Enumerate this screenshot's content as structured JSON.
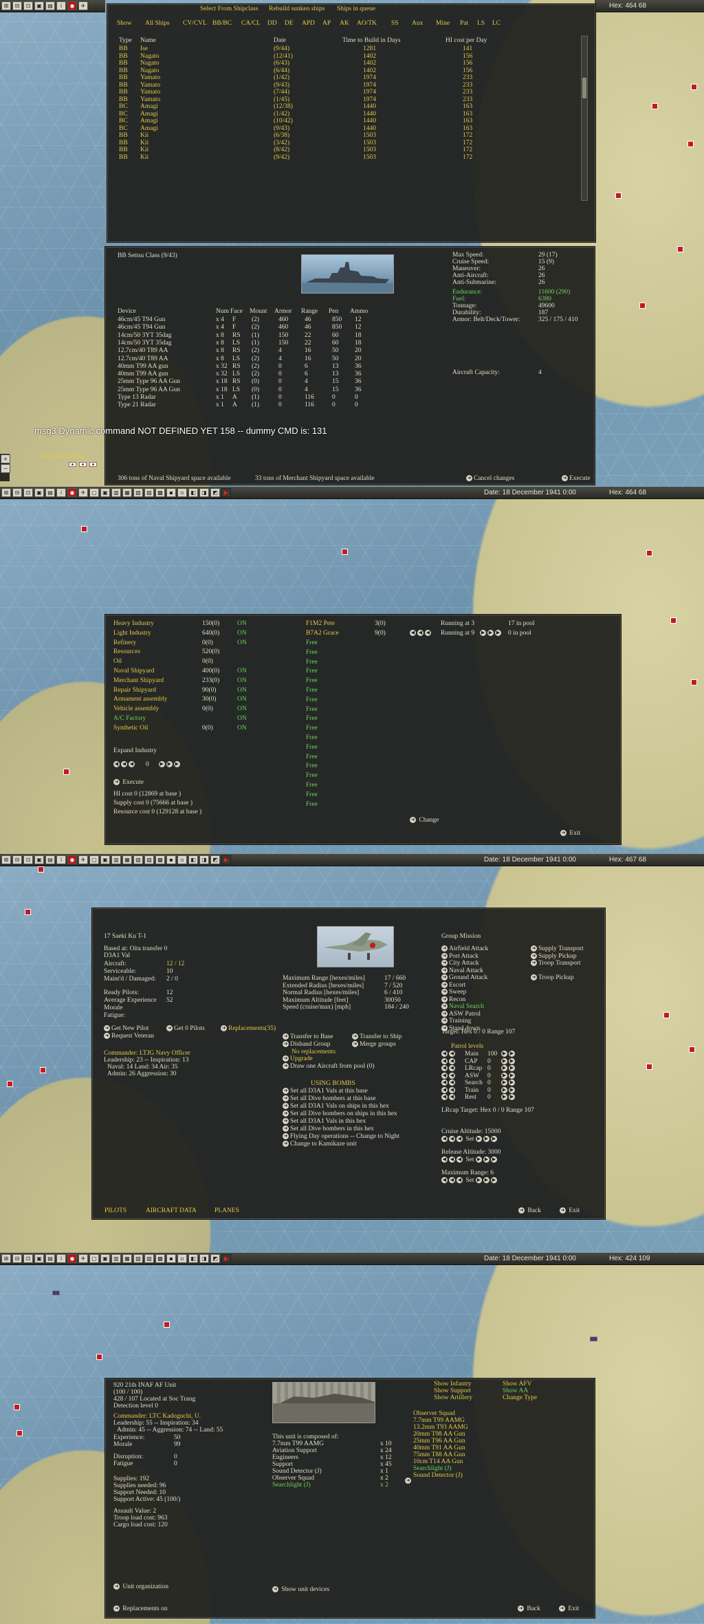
{
  "toolbar": {
    "date_label": "Date: 18 December 1941 0:00",
    "hex_label_1": "Hex: 464  68",
    "hex_label_2": "Hex: 464  68",
    "hex_label_3": "Hex: 467  68",
    "hex_label_4": "Hex: 424  109",
    "buttons": [
      "⊞",
      "⊟",
      "⊡",
      "▣",
      "▤",
      "i",
      "◉",
      "✈",
      "▢",
      "▣",
      "▥",
      "▦",
      "▧",
      "▨",
      "▩",
      "▪",
      "▫",
      "◧",
      "◨",
      "◩",
      "▶"
    ]
  },
  "shipyard": {
    "top_links": [
      "Select From Shipclass",
      "Rebuild sunken ships",
      "Ships in queue"
    ],
    "filters": [
      "Show",
      "All Ships",
      "CV/CVL",
      "BB/BC",
      "CA/CL",
      "DD",
      "DE",
      "APD",
      "AP",
      "AK",
      "AO/TK",
      "SS",
      "Aux",
      "Mine",
      "Pat",
      "LS",
      "LC"
    ],
    "columns": [
      "Type",
      "Name",
      "Date",
      "Time to Build in Days",
      "HI cost per Day"
    ],
    "rows": [
      [
        "BB",
        "Ise",
        "(9/44)",
        "1281",
        "141"
      ],
      [
        "BB",
        "Nagato",
        "(12/41)",
        "1402",
        "156"
      ],
      [
        "BB",
        "Nagato",
        "(6/43)",
        "1402",
        "156"
      ],
      [
        "BB",
        "Nagato",
        "(6/44)",
        "1402",
        "156"
      ],
      [
        "BB",
        "Yamato",
        "(1/42)",
        "1974",
        "233"
      ],
      [
        "BB",
        "Yamato",
        "(9/43)",
        "1974",
        "233"
      ],
      [
        "BB",
        "Yamato",
        "(7/44)",
        "1974",
        "233"
      ],
      [
        "BB",
        "Yamato",
        "(1/45)",
        "1974",
        "233"
      ],
      [
        "BC",
        "Amagi",
        "(12/38)",
        "1440",
        "163"
      ],
      [
        "BC",
        "Amagi",
        "(1/42)",
        "1440",
        "163"
      ],
      [
        "BC",
        "Amagi",
        "(10/42)",
        "1440",
        "163"
      ],
      [
        "BC",
        "Amagi",
        "(9/43)",
        "1440",
        "163"
      ],
      [
        "BB",
        "Kii",
        "(6/38)",
        "1503",
        "172"
      ],
      [
        "BB",
        "Kii",
        "(3/42)",
        "1503",
        "172"
      ],
      [
        "BB",
        "Kii",
        "(8/42)",
        "1503",
        "172"
      ],
      [
        "BB",
        "Kii",
        "(9/42)",
        "1503",
        "172"
      ]
    ]
  },
  "ship_detail": {
    "title": "BB Settsu Class (9/43)",
    "columns": [
      "Device",
      "Num",
      "Face",
      "Mount",
      "Armor",
      "Range",
      "Pen",
      "Ammo"
    ],
    "devices": [
      [
        "46cm/45 T94 Gun",
        "x 4",
        "F",
        "(2)",
        "460",
        "46",
        "850",
        "12"
      ],
      [
        "46cm/45 T94 Gun",
        "x 4",
        "F",
        "(2)",
        "460",
        "46",
        "850",
        "12"
      ],
      [
        "14cm/50 3YT 35dag",
        "x 8",
        "RS",
        "(1)",
        "150",
        "22",
        "60",
        "18"
      ],
      [
        "14cm/50 3YT 35dag",
        "x 8",
        "LS",
        "(1)",
        "150",
        "22",
        "60",
        "18"
      ],
      [
        "12.7cm/40 T89 AA",
        "x 8",
        "RS",
        "(2)",
        "4",
        "16",
        "50",
        "20"
      ],
      [
        "12.7cm/40 T89 AA",
        "x 8",
        "LS",
        "(2)",
        "4",
        "16",
        "50",
        "20"
      ],
      [
        "40mm T99 AA gun",
        "x 32",
        "RS",
        "(2)",
        "0",
        "6",
        "13",
        "36"
      ],
      [
        "40mm T99 AA gun",
        "x 32",
        "LS",
        "(2)",
        "0",
        "6",
        "13",
        "36"
      ],
      [
        "25mm Type 96 AA Gun",
        "x 18",
        "RS",
        "(0)",
        "0",
        "4",
        "15",
        "36"
      ],
      [
        "25mm Type 96 AA Gun",
        "x 18",
        "LS",
        "(0)",
        "0",
        "4",
        "15",
        "36"
      ],
      [
        "Type 13 Radar",
        "x 1",
        "A",
        "(1)",
        "0",
        "116",
        "0",
        "0"
      ],
      [
        "Type 21 Radar",
        "x 1",
        "A",
        "(1)",
        "0",
        "116",
        "0",
        "0"
      ]
    ],
    "stats": [
      [
        "Max Speed:",
        "29 (17)",
        "w"
      ],
      [
        "Cruise Speed:",
        "15 (9)",
        "w"
      ],
      [
        "Maneuver:",
        "26",
        "w"
      ],
      [
        "Anti-Aircraft:",
        "26",
        "w"
      ],
      [
        "Anti-Submarine:",
        "26",
        "w"
      ],
      [
        "Endurance:",
        "11600 (290)",
        "g"
      ],
      [
        "Fuel:",
        "6380",
        "g"
      ],
      [
        "Tonnage:",
        "49600",
        "w"
      ],
      [
        "Durability:",
        "187",
        "w"
      ],
      [
        "Armor: Belt/Deck/Tower:",
        "325 / 175 / 410",
        "w"
      ]
    ],
    "aircraft_capacity_label": "Aircraft Capacity:",
    "aircraft_capacity_value": "4",
    "naval_space": "306 tons of Naval Shipyard space available",
    "merchant_space": "33 tons of Merchant Shipyard space available",
    "cancel_label": "Cancel changes",
    "execute_label": "Execute"
  },
  "debug_message": "msg3 Dynamic command NOT DEFINED YET 158 -- dummy CMD is: 131",
  "base_label": "Nagasaki/Sasebo",
  "industry": {
    "items": [
      [
        "Heavy Industry",
        "150(0)",
        "ON",
        "y"
      ],
      [
        "Light Industry",
        "640(0)",
        "ON",
        "y"
      ],
      [
        "Refinery",
        "0(0)",
        "ON",
        "y"
      ],
      [
        "Resources",
        "520(0)",
        "",
        "y"
      ],
      [
        "Oil",
        "0(0)",
        "",
        "y"
      ],
      [
        "Naval Shipyard",
        "400(0)",
        "ON",
        "y"
      ],
      [
        "Merchant Shipyard",
        "233(0)",
        "ON",
        "y"
      ],
      [
        "Repair Shipyard",
        "90(0)",
        "ON",
        "y"
      ],
      [
        "Armament assembly",
        "30(0)",
        "ON",
        "y"
      ],
      [
        "Vehicle assembly",
        "0(0)",
        "ON",
        "y"
      ],
      [
        "A/C Factory",
        "",
        "ON",
        "g"
      ],
      [
        "Synthetic Oil",
        "0(0)",
        "ON",
        "y"
      ]
    ],
    "factories": [
      [
        "F1M2 Pete",
        "3(0)",
        "Running at 3",
        "17 in pool"
      ],
      [
        "B7A2 Grace",
        "9(0)",
        "Running at 9",
        "0 in pool"
      ]
    ],
    "free_label": "Free",
    "free_count": 18,
    "expand_label": "Expand Industry",
    "expand_value": "0",
    "execute_label": "Execute",
    "hi_cost": "HI cost 0 (12869 at base )",
    "supply_cost": "Supply cost 0 (75666 at base )",
    "resource_cost": "Resource cost 0 (129128 at base )",
    "change_label": "Change",
    "exit_label": "Exit"
  },
  "air_group": {
    "name": "17 Saeki Ku T-1",
    "based_at": "Based at: Oita transfer 0",
    "aircraft_type": "D3A1 Val",
    "aircraft_label": "Aircraft:",
    "aircraft_value": "12 / 12",
    "serviceable_label": "Serviceable:",
    "serviceable_value": "10",
    "maint_label": "Maint'd / Damaged:",
    "maint_value": "2 / 0",
    "ready_pilots_label": "Ready Pilots:",
    "ready_pilots_value": "12",
    "avg_exp_label": "Average Experience",
    "avg_exp_value": "52",
    "morale_label": "Morale",
    "fatigue_label": "Fatigue:",
    "get_new_pilot": "Get New Pilot",
    "get_0_pilots": "Get 0 Pilots",
    "replacements": "Replacements(35)",
    "request_veteran": "Request Veteran",
    "commander": "Commander: LTJG Navy Officer",
    "leadership": "Leadership: 23 -- Inspiration: 13",
    "naval_land": "Naval: 14  Land: 34  Air: 35",
    "admin": "Admin: 26  Aggression: 30",
    "range_stats": [
      [
        "Maximum Range [hexes/miles]",
        "17 / 660"
      ],
      [
        "Extended Radius [hexes/miles]",
        "7 / 520"
      ],
      [
        "Normal Radius [hexes/miles]",
        "6 / 410"
      ],
      [
        "Maximum Altitude [feet]",
        "30050"
      ],
      [
        "Speed (cruise/max) [mph]",
        "184 / 240"
      ]
    ],
    "actions": [
      "Transfer to Base",
      "Transfer to Ship",
      "Disband Group",
      "Merge groups"
    ],
    "no_replacements": "No replacements",
    "upgrade": "Upgrade",
    "draw_aircraft": "Draw one Aircraft from pool (0)",
    "using_bombs": "USING BOMBS",
    "set_actions": [
      "Set all D3A1 Vals at this base",
      "Set all Dive bombers at this base",
      "Set all D3A1 Vals on ships in this hex",
      "Set all Dive bombers on ships in this hex",
      "Set all D3A1 Vals in this hex",
      "Set all Dive bombers in this hex",
      "Flying Day operations -- Change to Night",
      "Change to Kamikaze unit"
    ],
    "group_mission_label": "Group Mission",
    "missions_left": [
      "Airfield Attack",
      "Port Attack",
      "City Attack",
      "Naval Attack",
      "Ground Attack",
      "Escort",
      "Sweep",
      "Recon",
      "Naval Search",
      "ASW Patrol",
      "Training",
      "Stand down"
    ],
    "missions_right": [
      "Supply Transport",
      "Supply Pickup",
      "Troop Transport",
      "",
      "Troop Pickup"
    ],
    "target_line": "Target: Hex 0 / 0 Range 107",
    "patrol_label": "Patrol levels",
    "patrol_items": [
      [
        "Main",
        "100"
      ],
      [
        "CAP",
        "0"
      ],
      [
        "LRcap",
        "0"
      ],
      [
        "ASW",
        "0"
      ],
      [
        "Search",
        "0"
      ],
      [
        "Train",
        "0"
      ],
      [
        "Rest",
        "0"
      ]
    ],
    "lrcap_target": "LRcap Target: Hex 0 / 0 Range 107",
    "cruise_alt": "Cruise Altitude: 15000",
    "release_alt": "Release Altitude: 3000",
    "max_range": "Maximum Range: 6",
    "set_label": "Set",
    "bottom_links": [
      "PILOTS",
      "AIRCRAFT DATA",
      "PLANES"
    ],
    "back_label": "Back",
    "exit_label": "Exit"
  },
  "ground_unit": {
    "name": "920 21th INAF AF Unit",
    "strength": "(100 / 100)",
    "location": "428 / 107 Located at Soc Trang",
    "detection": "Detection level 0",
    "commander": "Commander: LTC Kadoguchi, U.",
    "leadership": "Leadership: 55 -- Inspiration: 34",
    "admin": "Admin: 45 -- Aggression: 74 -- Land: 55",
    "experience_label": "Experience:",
    "experience_value": "50",
    "morale_label": "Morale",
    "morale_value": "99",
    "disruption_label": "Disruption:",
    "disruption_value": "0",
    "fatigue_label": "Fatigue",
    "fatigue_value": "0",
    "supplies": "Supplies: 192",
    "supplies_needed": "Supplies needed: 96",
    "support_needed": "Support Needed: 10",
    "support_active": "Support Active: 45 (100/)",
    "assault": "Assault Value: 2",
    "troop_load": "Troop load cost: 963",
    "cargo_load": "Cargo load cost: 120",
    "composed_label": "This unit is composed of:",
    "composition": [
      [
        "7.7mm T99 AAMG",
        "x 10",
        "w"
      ],
      [
        "Aviation Support",
        "x 24",
        "w"
      ],
      [
        "Engineers",
        "x 12",
        "w"
      ],
      [
        "Support",
        "x 45",
        "w"
      ],
      [
        "Sound Detector (J)",
        "x 1",
        "w"
      ],
      [
        "Observer Squad",
        "x 2",
        "w"
      ],
      [
        "Searchlight (J)",
        "x 2",
        "g"
      ]
    ],
    "show_col1": [
      "Show Infantry",
      "Show Support",
      "Show Artillery"
    ],
    "show_col2": [
      "Show AFV",
      "Show AA",
      "Change Type"
    ],
    "upgrade_list": [
      [
        "Observer Squad",
        "y"
      ],
      [
        "7.7mm T99 AAMG",
        "y"
      ],
      [
        "13.2mm T93 AAMG",
        "y"
      ],
      [
        "20mm T98 AA Gun",
        "y"
      ],
      [
        "25mm T96 AA Gun",
        "y"
      ],
      [
        "40mm T91 AA Gun",
        "y"
      ],
      [
        "75mm T88 AA Gun",
        "y"
      ],
      [
        "10cm T14 AA Gun",
        "y"
      ],
      [
        "Searchlight (J)",
        "g"
      ],
      [
        "Sound Detector (J)",
        "y"
      ]
    ],
    "unit_organization": "Unit organization",
    "show_devices": "Show unit devices",
    "replacements_on": "Replacements on",
    "back_label": "Back",
    "exit_label": "Exit"
  }
}
